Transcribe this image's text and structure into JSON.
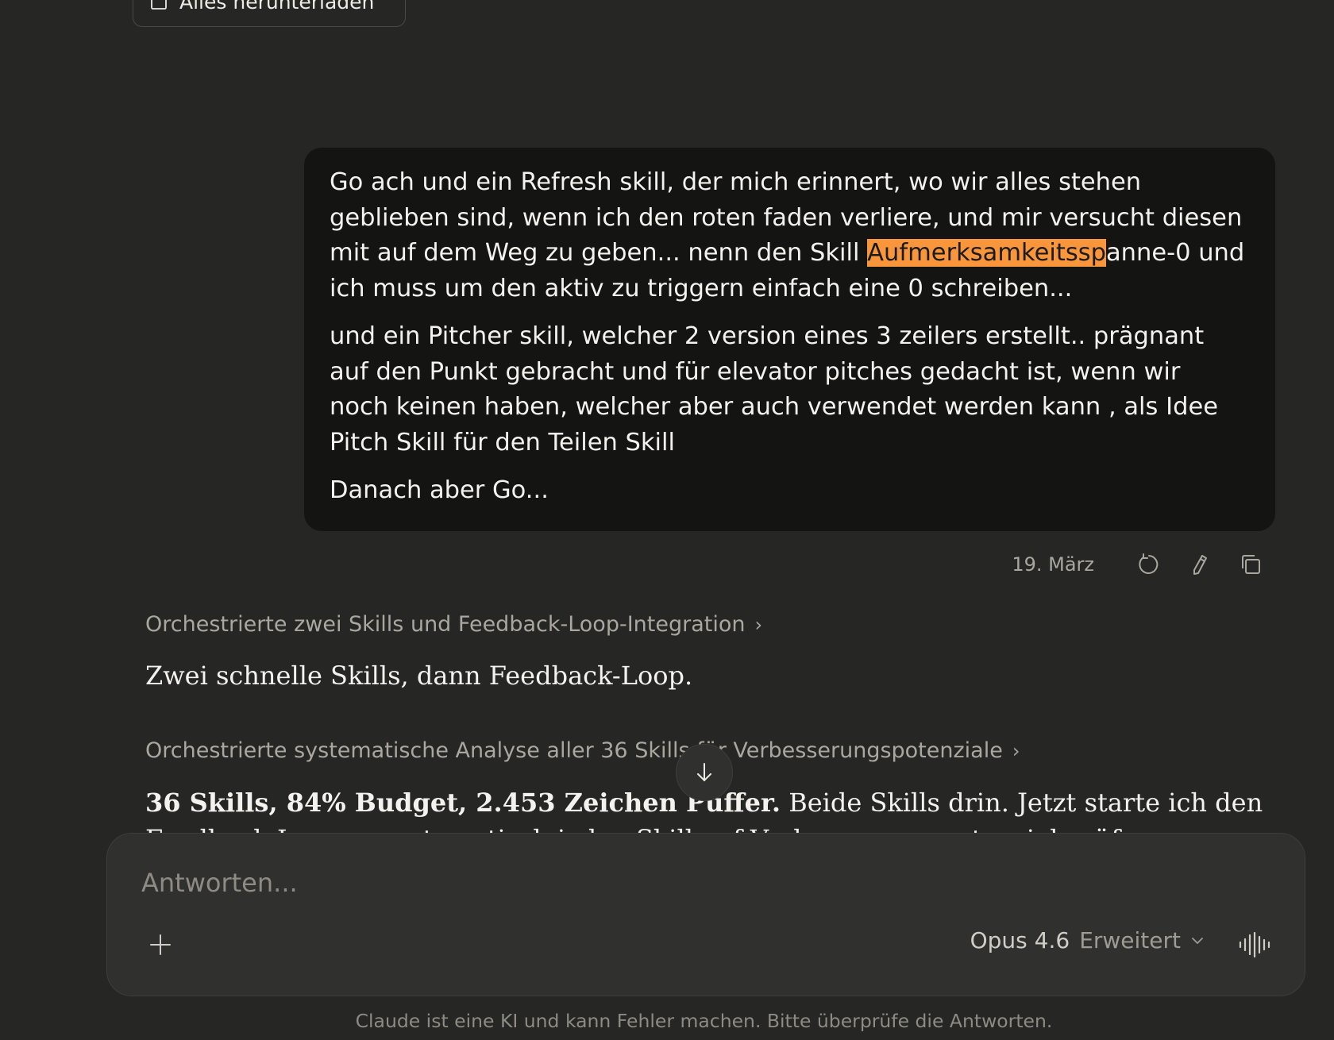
{
  "download": {
    "label": "Alles herunterladen"
  },
  "user_message": {
    "paragraph1_before": "Go ach und ein Refresh skill, der mich erinnert, wo wir alles stehen geblieben sind, wenn ich den roten faden verliere, und mir versucht diesen mit auf dem Weg zu geben... nenn den Skill ",
    "paragraph1_highlight": "Aufmerksamkeitssp",
    "paragraph1_after": "anne-0 und ich muss um den aktiv zu triggern einfach eine 0 schreiben...",
    "paragraph2": "und ein Pitcher skill, welcher 2 version eines 3 zeilers erstellt.. prägnant auf den Punkt gebracht und für elevator pitches gedacht ist, wenn wir noch keinen haben, welcher aber auch verwendet werden kann , als Idee Pitch Skill für den Teilen Skill",
    "paragraph3": "Danach aber Go..."
  },
  "meta": {
    "date": "19. März",
    "icons": [
      "retry-icon",
      "edit-icon",
      "copy-icon"
    ]
  },
  "assistant": {
    "thought1": "Orchestrierte zwei Skills und Feedback-Loop-Integration",
    "answer1": "Zwei schnelle Skills, dann Feedback-Loop.",
    "thought2": "Orchestrierte systematische Analyse aller 36 Skills für Verbesserungspotenziale",
    "answer2_bold": "36 Skills, 84% Budget, 2.453 Zeichen Puffer.",
    "answer2_rest": " Beide Skills drin. Jetzt starte ich den",
    "answer2_line2": "Feedback-Loop — systematisch jeden Skill auf Verbesserungspotenzial prüfen..."
  },
  "composer": {
    "placeholder": "Antworten...",
    "model_name": "Opus 4.6",
    "model_mode": "Erweitert"
  },
  "disclaimer": "Claude ist eine KI und kann Fehler machen. Bitte überprüfe die Antworten."
}
